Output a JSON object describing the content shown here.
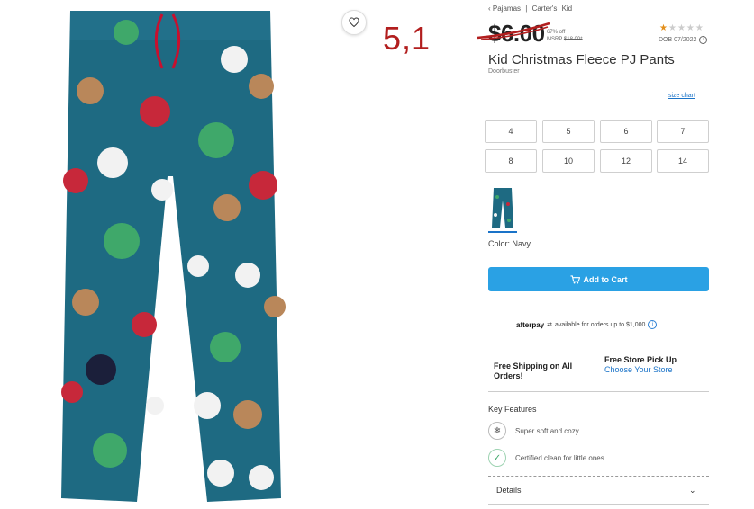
{
  "breadcrumb": [
    "‹ Pajamas",
    "|",
    "Carter's",
    "Kid"
  ],
  "annotation_text": "5,1",
  "price": {
    "current": "$6.00",
    "percent_off": "67% off",
    "msrp_label": "MSRP",
    "msrp_value": "$18.00*"
  },
  "rating": {
    "stars": 1,
    "max": 5
  },
  "dob": "DOB 07/2022",
  "product": {
    "title": "Kid Christmas Fleece PJ Pants",
    "subtitle": "Doorbuster",
    "image_icon": "pajama-pants-image"
  },
  "size_chart_label": "size chart",
  "sizes": [
    "4",
    "5",
    "6",
    "7",
    "8",
    "10",
    "12",
    "14"
  ],
  "color": {
    "label": "Color:",
    "value": "Navy",
    "hex": "#1d5d78"
  },
  "add_to_cart": {
    "label": "Add to Cart",
    "icon": "cart-icon",
    "bg": "#2aa1e4"
  },
  "afterpay": {
    "brand": "afterpay",
    "text": "available for orders up to $1,000"
  },
  "shipping": {
    "free_shipping": "Free Shipping on All Orders!",
    "pickup_title": "Free Store Pick Up",
    "pickup_link": "Choose Your Store"
  },
  "key_features": {
    "title": "Key Features",
    "items": [
      {
        "icon": "snowflake-badge-icon",
        "label": "Super soft and cozy"
      },
      {
        "icon": "leaf-badge-icon",
        "label": "Certified clean for little ones"
      }
    ]
  },
  "details_label": "Details",
  "colors": {
    "accent": "#2aa1e4",
    "link": "#1a73c8",
    "annotation": "#b21e1e",
    "star": "#e38f1b"
  }
}
